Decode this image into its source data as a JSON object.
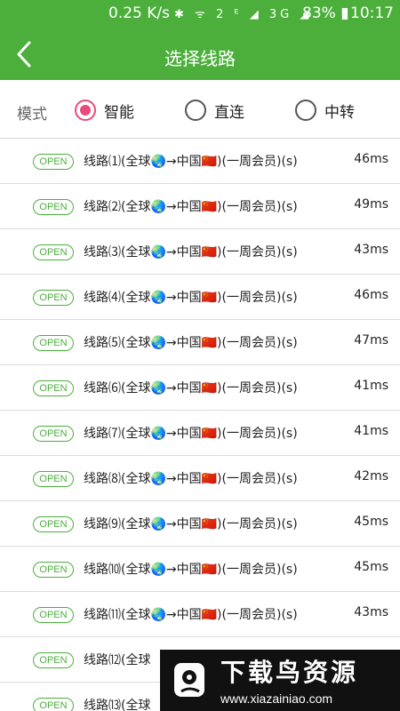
{
  "status_bar": {
    "speed": "0.25 K/s",
    "icons": "✱ ᯤ 2 ᴱ ◢ 3G ◢",
    "battery": "83% ▮",
    "time": "10:17"
  },
  "header": {
    "title": "选择线路",
    "back_icon": "chevron-left-icon",
    "color": "#4caf3c"
  },
  "mode": {
    "label": "模式",
    "selected": "智能",
    "options": [
      {
        "label": "智能",
        "checked": true
      },
      {
        "label": "直连",
        "checked": false
      },
      {
        "label": "中转",
        "checked": false
      }
    ]
  },
  "routes": [
    {
      "badge": "OPEN",
      "name": "线路⑴(全球🌏→中国🇨🇳)(一周会员)(s)",
      "latency": "46ms"
    },
    {
      "badge": "OPEN",
      "name": "线路⑵(全球🌏→中国🇨🇳)(一周会员)(s)",
      "latency": "49ms"
    },
    {
      "badge": "OPEN",
      "name": "线路⑶(全球🌏→中国🇨🇳)(一周会员)(s)",
      "latency": "43ms"
    },
    {
      "badge": "OPEN",
      "name": "线路⑷(全球🌏→中国🇨🇳)(一周会员)(s)",
      "latency": "46ms"
    },
    {
      "badge": "OPEN",
      "name": "线路⑸(全球🌏→中国🇨🇳)(一周会员)(s)",
      "latency": "47ms"
    },
    {
      "badge": "OPEN",
      "name": "线路⑹(全球🌏→中国🇨🇳)(一周会员)(s)",
      "latency": "41ms"
    },
    {
      "badge": "OPEN",
      "name": "线路⑺(全球🌏→中国🇨🇳)(一周会员)(s)",
      "latency": "41ms"
    },
    {
      "badge": "OPEN",
      "name": "线路⑻(全球🌏→中国🇨🇳)(一周会员)(s)",
      "latency": "42ms"
    },
    {
      "badge": "OPEN",
      "name": "线路⑼(全球🌏→中国🇨🇳)(一周会员)(s)",
      "latency": "45ms"
    },
    {
      "badge": "OPEN",
      "name": "线路⑽(全球🌏→中国🇨🇳)(一周会员)(s)",
      "latency": "45ms"
    },
    {
      "badge": "OPEN",
      "name": "线路⑾(全球🌏→中国🇨🇳)(一周会员)(s)",
      "latency": "43ms"
    },
    {
      "badge": "OPEN",
      "name": "线路⑿(全球",
      "latency": ""
    },
    {
      "badge": "OPEN",
      "name": "线路⒀(全球",
      "latency": ""
    }
  ],
  "watermark": {
    "title": "下载鸟资源",
    "url": "www.xiazainiao.com"
  }
}
